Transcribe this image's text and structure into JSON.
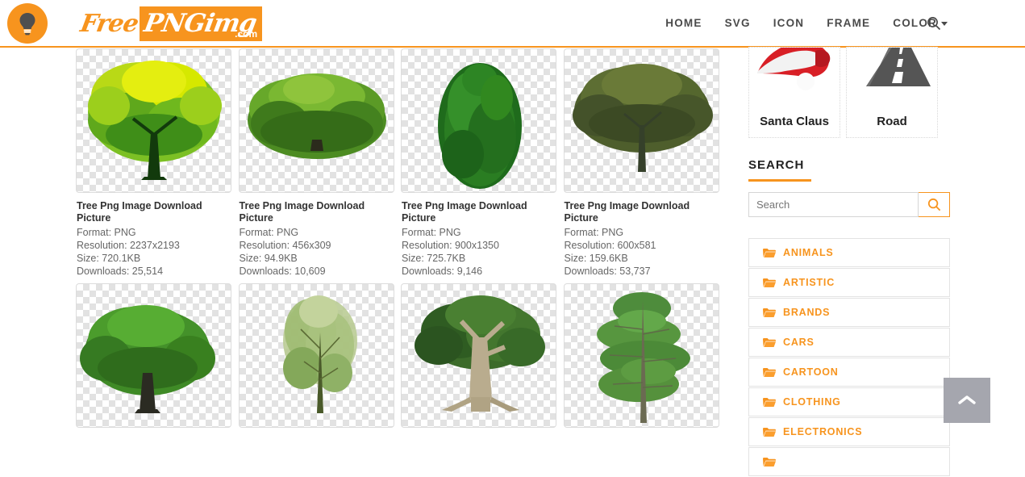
{
  "header": {
    "bulb_icon": "lightbulb-icon",
    "logo": {
      "free": "Free",
      "png": "PNGimg",
      "com": ".com"
    },
    "nav": [
      {
        "label": "HOME",
        "name": "nav-home"
      },
      {
        "label": "SVG",
        "name": "nav-svg"
      },
      {
        "label": "ICON",
        "name": "nav-icon"
      },
      {
        "label": "FRAME",
        "name": "nav-frame"
      },
      {
        "label": "COLOR",
        "name": "nav-color",
        "has_dropdown": true
      }
    ],
    "search_icon": "search-icon",
    "accent_color": "#f7941e"
  },
  "gallery": {
    "items": [
      {
        "title": "Tree Png Image Download Picture",
        "format": "Format: PNG",
        "resolution": "Resolution: 2237x2193",
        "size": "Size: 720.1KB",
        "downloads": "Downloads: 25,514",
        "thumb": "yellow-green-broad-tree"
      },
      {
        "title": "Tree Png Image Download Picture",
        "format": "Format: PNG",
        "resolution": "Resolution: 456x309",
        "size": "Size: 94.9KB",
        "downloads": "Downloads: 10,609",
        "thumb": "wide-bushy-canopy-tree"
      },
      {
        "title": "Tree Png Image Download Picture",
        "format": "Format: PNG",
        "resolution": "Resolution: 900x1350",
        "size": "Size: 725.7KB",
        "downloads": "Downloads: 9,146",
        "thumb": "dark-green-conifer"
      },
      {
        "title": "Tree Png Image Download Picture",
        "format": "Format: PNG",
        "resolution": "Resolution: 600x581",
        "size": "Size: 159.6KB",
        "downloads": "Downloads: 53,737",
        "thumb": "olive-green-tree"
      }
    ],
    "row2_thumbs": [
      "dense-green-oak",
      "sparse-light-green-tree",
      "thick-trunk-rooted-tree",
      "tall-slender-tree"
    ]
  },
  "sidebar": {
    "top_cards": [
      {
        "caption": "Santa Claus",
        "image": "santa-hat-image"
      },
      {
        "caption": "Road",
        "image": "road-perspective-image"
      }
    ],
    "search": {
      "heading": "SEARCH",
      "placeholder": "Search",
      "value": "",
      "button_icon": "search-icon"
    },
    "categories": [
      {
        "label": "ANIMALS"
      },
      {
        "label": "ARTISTIC"
      },
      {
        "label": "BRANDS"
      },
      {
        "label": "CARS"
      },
      {
        "label": "CARTOON"
      },
      {
        "label": "CLOTHING"
      },
      {
        "label": "ELECTRONICS"
      },
      {
        "label": ""
      }
    ]
  },
  "scroll_to_top": {
    "icon": "chevron-up-icon"
  }
}
